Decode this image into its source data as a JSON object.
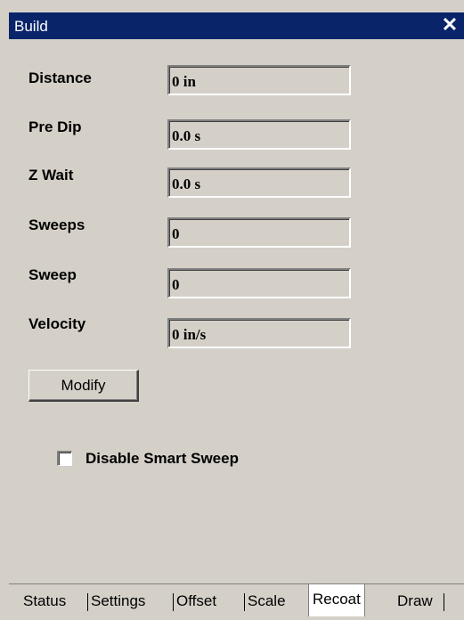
{
  "window": {
    "title": "Build",
    "close_glyph": "✕"
  },
  "fields": [
    {
      "label": "Distance",
      "value": "0 in"
    },
    {
      "label": "Pre Dip",
      "value": "0.0 s"
    },
    {
      "label": "Z Wait",
      "value": "0.0 s"
    },
    {
      "label": "Sweeps",
      "value": "0"
    },
    {
      "label": "Sweep",
      "value": "0"
    },
    {
      "label": "Velocity",
      "value": "0 in/s"
    }
  ],
  "modify_button": {
    "label": "Modify"
  },
  "smart_sweep": {
    "label": "Disable Smart Sweep",
    "checked": false
  },
  "tabs": [
    {
      "label": "Status",
      "active": false
    },
    {
      "label": "Settings",
      "active": false
    },
    {
      "label": "Offset",
      "active": false
    },
    {
      "label": "Scale",
      "active": false
    },
    {
      "label": "Recoat",
      "active": true
    },
    {
      "label": "Draw",
      "active": false
    }
  ]
}
